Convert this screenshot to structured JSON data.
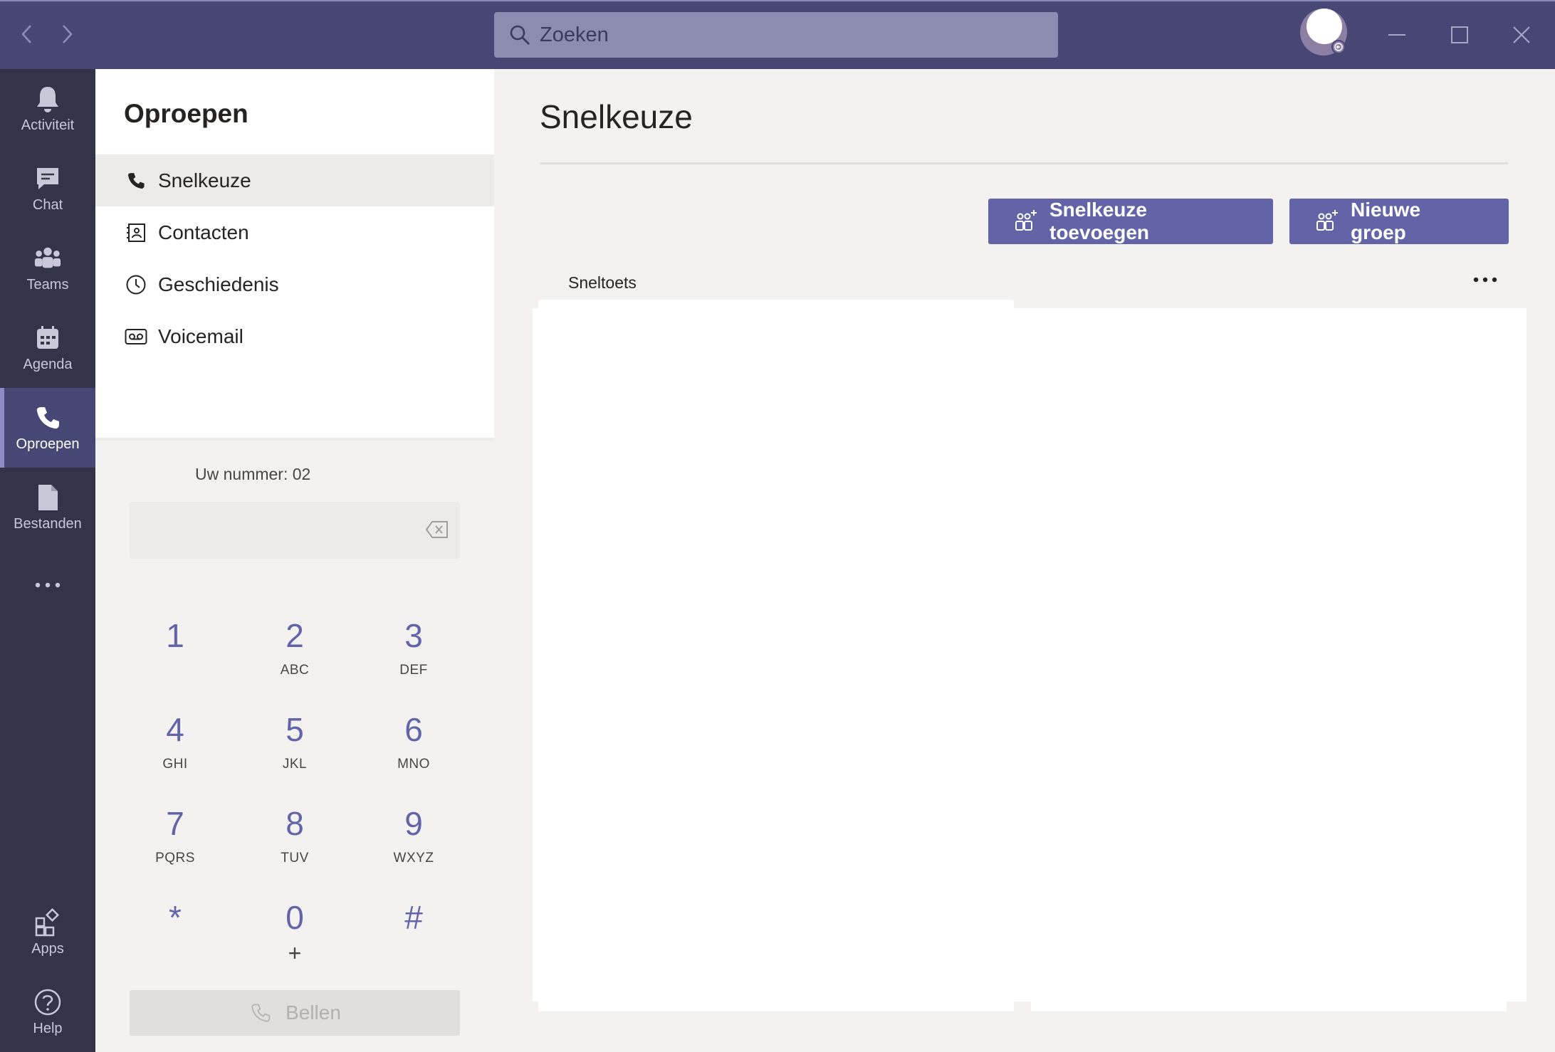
{
  "search": {
    "placeholder": "Zoeken"
  },
  "rail": {
    "items": [
      {
        "label": "Activiteit",
        "icon": "bell-icon"
      },
      {
        "label": "Chat",
        "icon": "chat-icon"
      },
      {
        "label": "Teams",
        "icon": "teams-icon"
      },
      {
        "label": "Agenda",
        "icon": "calendar-icon"
      },
      {
        "label": "Oproepen",
        "icon": "phone-icon",
        "active": true
      },
      {
        "label": "Bestanden",
        "icon": "file-icon"
      },
      {
        "label": "Apps",
        "icon": "apps-icon"
      },
      {
        "label": "Help",
        "icon": "help-icon"
      }
    ]
  },
  "calls": {
    "title": "Oproepen",
    "nav": [
      {
        "label": "Snelkeuze",
        "icon": "phone-icon",
        "selected": true
      },
      {
        "label": "Contacten",
        "icon": "contacts-icon"
      },
      {
        "label": "Geschiedenis",
        "icon": "clock-icon"
      },
      {
        "label": "Voicemail",
        "icon": "voicemail-icon"
      }
    ],
    "your_number": "Uw nummer: 02",
    "keypad": [
      {
        "digit": "1",
        "letters": ""
      },
      {
        "digit": "2",
        "letters": "ABC"
      },
      {
        "digit": "3",
        "letters": "DEF"
      },
      {
        "digit": "4",
        "letters": "GHI"
      },
      {
        "digit": "5",
        "letters": "JKL"
      },
      {
        "digit": "6",
        "letters": "MNO"
      },
      {
        "digit": "7",
        "letters": "PQRS"
      },
      {
        "digit": "8",
        "letters": "TUV"
      },
      {
        "digit": "9",
        "letters": "WXYZ"
      },
      {
        "digit": "*",
        "letters": ""
      },
      {
        "digit": "0",
        "letters": "+"
      },
      {
        "digit": "#",
        "letters": ""
      }
    ],
    "call_button": "Bellen"
  },
  "main": {
    "title": "Snelkeuze",
    "add_speed_dial": "Snelkeuze toevoegen",
    "new_group": "Nieuwe groep",
    "section_header": "Sneltoets"
  },
  "colors": {
    "accent": "#6264a7",
    "titlebar": "#464775",
    "rail": "#33344a"
  }
}
